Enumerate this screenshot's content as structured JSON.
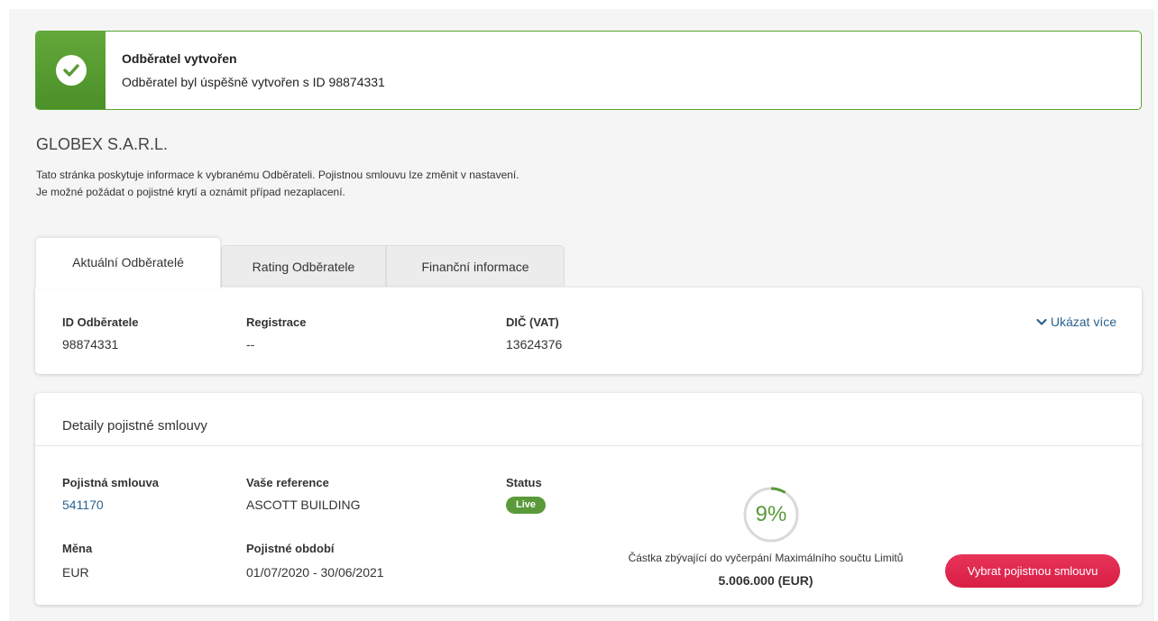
{
  "alert": {
    "icon": "check-icon",
    "title": "Odběratel vytvořen",
    "message": "Odběratel byl úspěšně vytvořen s ID 98874331",
    "color": "#5aa532"
  },
  "company": {
    "name": "GLOBEX S.A.R.L.",
    "description_line1": "Tato stránka poskytuje informace k vybranému Odběrateli. Pojistnou smlouvu lze změnit v nastavení.",
    "description_line2": "Je možné požádat o pojistné krytí a oznámit případ nezaplacení."
  },
  "tabs": [
    {
      "label": "Aktuální Odběratelé",
      "active": true
    },
    {
      "label": "Rating Odběratele",
      "active": false
    },
    {
      "label": "Finanční informace",
      "active": false
    }
  ],
  "customer": {
    "id_label": "ID Odběratele",
    "id_value": "98874331",
    "registration_label": "Registrace",
    "registration_value": "--",
    "vat_label": "DIČ (VAT)",
    "vat_value": "13624376",
    "show_more": "Ukázat více"
  },
  "policy": {
    "title": "Detaily pojistné smlouvy",
    "policy_label": "Pojistná smlouva",
    "policy_value": "541170",
    "reference_label": "Vaše reference",
    "reference_value": "ASCOTT BUILDING",
    "status_label": "Status",
    "status_value": "Live",
    "currency_label": "Měna",
    "currency_value": "EUR",
    "period_label": "Pojistné období",
    "period_value": "01/07/2020 - 30/06/2021",
    "gauge_percent": 9,
    "gauge_text": "9%",
    "remaining_label": "Částka zbývající do vyčerpání Maximálního součtu Limitů",
    "remaining_value": "5.006.000 (EUR)",
    "select_button": "Vybrat pojistnou smlouvu",
    "accent_color": "#5a9a3a",
    "button_color": "#e0294f"
  }
}
